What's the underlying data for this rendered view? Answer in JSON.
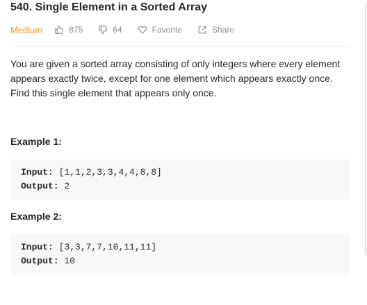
{
  "problem": {
    "title": "540. Single Element in a Sorted Array",
    "difficulty": "Medium",
    "likes": "875",
    "dislikes": "64",
    "favorite_label": "Favorite",
    "share_label": "Share",
    "description": "You are given a sorted array consisting of only integers where every element appears exactly twice, except for one element which appears exactly once. Find this single element that appears only once."
  },
  "examples": [
    {
      "title": "Example 1:",
      "input_label": "Input:",
      "input": "[1,1,2,3,3,4,4,8,8]",
      "output_label": "Output:",
      "output": "2"
    },
    {
      "title": "Example 2:",
      "input_label": "Input:",
      "input": "[3,3,7,7,10,11,11]",
      "output_label": "Output:",
      "output": "10"
    }
  ],
  "colors": {
    "difficulty": "#ef9a1a",
    "meta": "#8c8c8c",
    "code_bg": "#f7f8fa"
  },
  "icons": [
    "thumbs-up-icon",
    "thumbs-down-icon",
    "heart-icon",
    "share-icon"
  ]
}
